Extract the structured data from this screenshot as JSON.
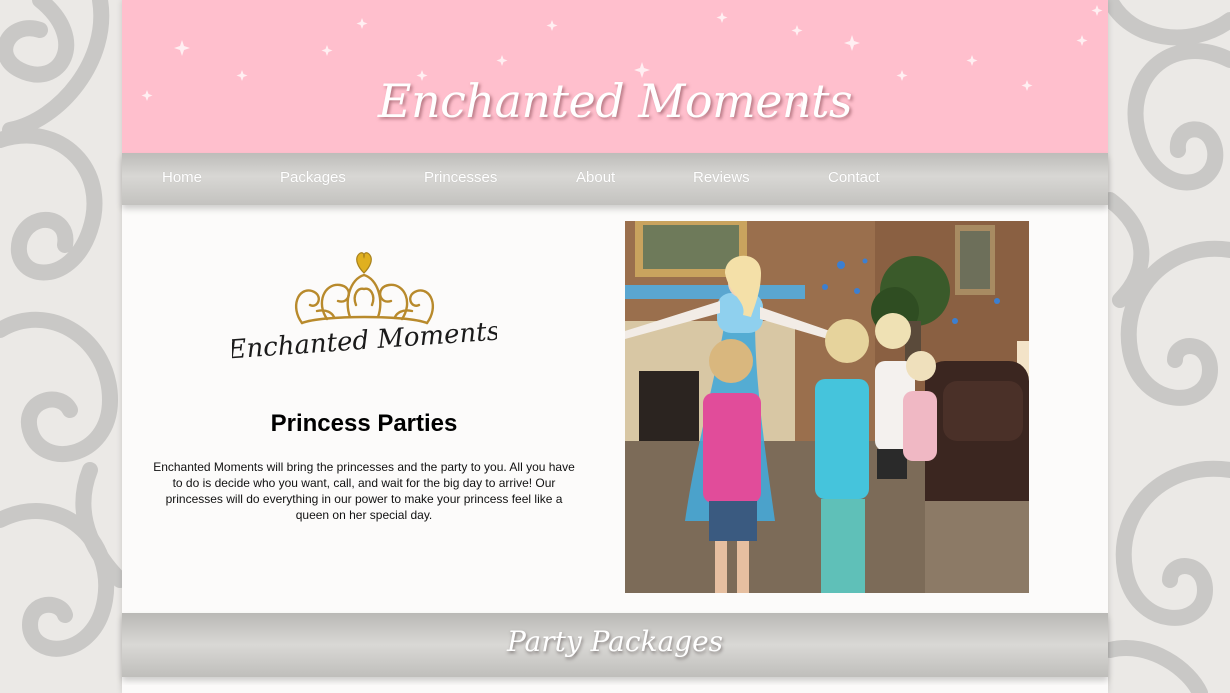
{
  "site": {
    "title": "Enchanted Moments"
  },
  "nav": {
    "items": [
      {
        "label": "Home"
      },
      {
        "label": "Packages"
      },
      {
        "label": "Princesses"
      },
      {
        "label": "About"
      },
      {
        "label": "Reviews"
      },
      {
        "label": "Contact"
      }
    ]
  },
  "logo": {
    "text": "Enchanted Moments",
    "icon": "tiara-icon"
  },
  "intro": {
    "heading": "Princess Parties",
    "body": "Enchanted Moments will bring the princesses and the party to you. All you have to do is decide who you want, call, and wait for the big day to arrive! Our princesses will do everything in our power to make your princess feel like a queen on her special day."
  },
  "photo": {
    "subject": "princess-party-photo"
  },
  "packages": {
    "title": "Party Packages"
  },
  "colors": {
    "header_pink": "#ffbfcd",
    "nav_gray": "#c9c8c5",
    "page_bg": "#fcfbfa",
    "backdrop": "#ebe9e6"
  }
}
